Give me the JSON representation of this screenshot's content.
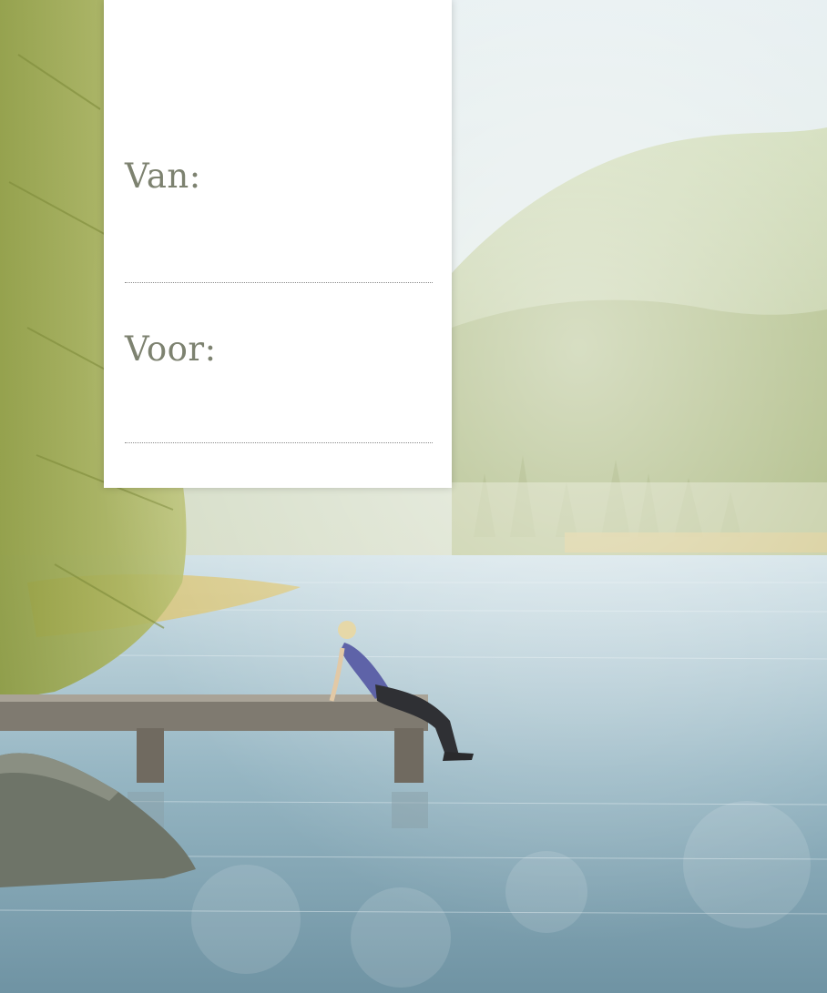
{
  "card": {
    "from_label": "Van:",
    "from_value": "",
    "to_label": "Voor:",
    "to_value": ""
  },
  "colors": {
    "card_background": "#ffffff",
    "label_color": "#7d8270",
    "sky": "#dfe9ea",
    "forest": "#a8b96d",
    "lake": "#7fa3b3"
  }
}
